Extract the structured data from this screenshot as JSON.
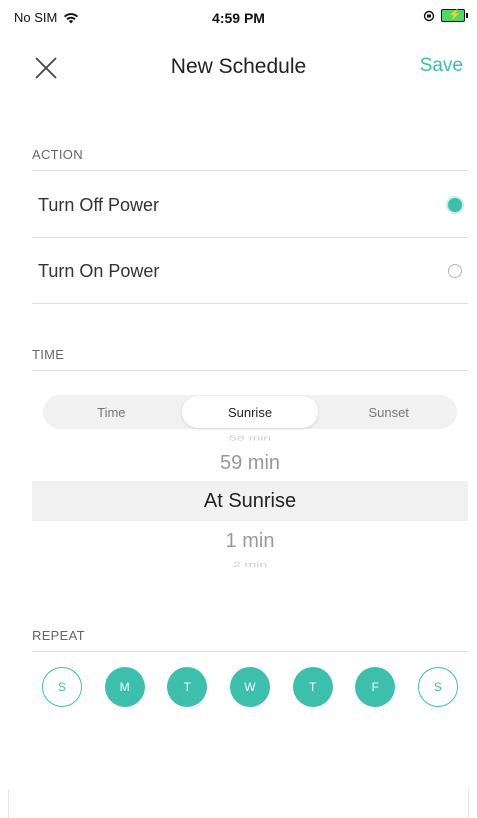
{
  "status_bar": {
    "carrier": "No SIM",
    "time": "4:59 PM"
  },
  "header": {
    "title": "New Schedule",
    "save_label": "Save"
  },
  "action": {
    "section_label": "ACTION",
    "options": [
      {
        "label": "Turn Off Power",
        "selected": true
      },
      {
        "label": "Turn On Power",
        "selected": false
      }
    ]
  },
  "time": {
    "section_label": "TIME",
    "tabs": [
      {
        "label": "Time",
        "active": false
      },
      {
        "label": "Sunrise",
        "active": true
      },
      {
        "label": "Sunset",
        "active": false
      }
    ],
    "picker": {
      "above2": "58 min",
      "above1": "59 min",
      "selected": "At Sunrise",
      "below1": "1 min",
      "below2": "2 min"
    }
  },
  "repeat": {
    "section_label": "REPEAT",
    "days": [
      {
        "label": "S",
        "selected": false
      },
      {
        "label": "M",
        "selected": true
      },
      {
        "label": "T",
        "selected": true
      },
      {
        "label": "W",
        "selected": true
      },
      {
        "label": "T",
        "selected": true
      },
      {
        "label": "F",
        "selected": true
      },
      {
        "label": "S",
        "selected": false
      }
    ]
  },
  "colors": {
    "accent": "#3dbfae",
    "highlight": "#f1f1f1"
  }
}
